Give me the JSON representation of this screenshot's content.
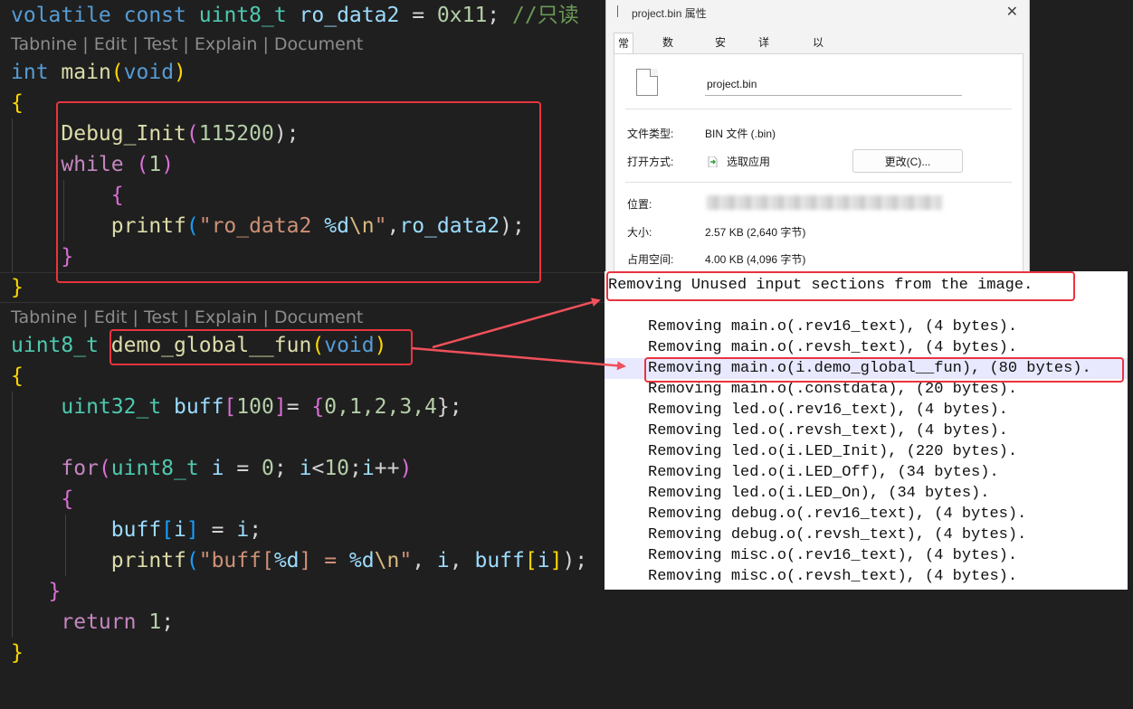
{
  "editor": {
    "codelens": "Tabnine | Edit | Test | Explain | Document",
    "line_rodata": {
      "t1": "volatile",
      "t2": "const",
      "t3": "uint8_t",
      "t4": "ro_data2",
      "t5": "=",
      "t6": "0x11",
      "t7": ";",
      "t8": "//只读"
    },
    "main_sig": {
      "t1": "int",
      "t2": "main",
      "t3": "(",
      "t4": "void",
      "t5": ")"
    },
    "brace_open": "{",
    "brace_close": "}",
    "debug_init": {
      "t1": "Debug_Init",
      "t2": "(",
      "t3": "115200",
      "t4": ");"
    },
    "while_line": {
      "t1": "while",
      "t2": "(",
      "t3": "1",
      "t4": ")"
    },
    "printf1": {
      "t1": "printf",
      "t2": "(",
      "t3": "\"ro_data2 ",
      "t4": "%d",
      "t5": "\\n",
      "t6": "\"",
      "t7": ",",
      "t8": "ro_data2",
      "t9": ");"
    },
    "fun_sig": {
      "t1": "uint8_t",
      "t2": "demo_global__fun",
      "t3": "(",
      "t4": "void",
      "t5": ")"
    },
    "buff_decl": {
      "t1": "uint32_t",
      "t2": "buff",
      "t3": "[",
      "t4": "100",
      "t5": "]",
      "t6": "=",
      "t7": "{",
      "t8": "0,1,2,3,4",
      "t9": "};"
    },
    "for_line": {
      "t1": "for",
      "t2": "(",
      "t3": "uint8_t",
      "t4": "i",
      "t5": "=",
      "t6": "0",
      "t7": ";",
      "t8": "i",
      "t9": "<",
      "t10": "10",
      "t11": ";",
      "t12": "i",
      "t13": "++",
      "t14": ")"
    },
    "assign_line": {
      "t1": "buff",
      "t2": "[",
      "t3": "i",
      "t4": "]",
      "t5": "=",
      "t6": "i",
      "t7": ";"
    },
    "printf2": {
      "t1": "printf",
      "t2": "(",
      "t3": "\"buff[",
      "t4": "%d",
      "t5": "] = ",
      "t6": "%d",
      "t7": "\\n",
      "t8": "\"",
      "t9": ",",
      "t10": "i",
      "t11": ",",
      "t12": "buff",
      "t13": "[",
      "t14": "i",
      "t15": "]",
      "t16": ");"
    },
    "return_line": {
      "t1": "return",
      "t2": "1",
      "t3": ";"
    }
  },
  "properties": {
    "title": "project.bin 属性",
    "close_glyph": "✕",
    "tabs": [
      {
        "label": "常规"
      },
      {
        "label": "数字签名"
      },
      {
        "label": "安全"
      },
      {
        "label": "详细信息"
      },
      {
        "label": "以前的版本"
      }
    ],
    "filename": "project.bin",
    "file_type_label": "文件类型:",
    "file_type_value": "BIN 文件 (.bin)",
    "open_with_label": "打开方式:",
    "open_with_value": "选取应用",
    "change_button": "更改(C)...",
    "location_label": "位置:",
    "size_label": "大小:",
    "size_value": "2.57 KB (2,640 字节)",
    "disk_label": "占用空间:",
    "disk_value": "4.00 KB (4,096 字节)"
  },
  "linker": {
    "header": "Removing Unused input sections from the image.",
    "rows": [
      "Removing main.o(.rev16_text), (4 bytes).",
      "Removing main.o(.revsh_text), (4 bytes).",
      "Removing main.o(i.demo_global__fun), (80 bytes).",
      "Removing main.o(.constdata), (20 bytes).",
      "Removing led.o(.rev16_text), (4 bytes).",
      "Removing led.o(.revsh_text), (4 bytes).",
      "Removing led.o(i.LED_Init), (220 bytes).",
      "Removing led.o(i.LED_Off), (34 bytes).",
      "Removing led.o(i.LED_On), (34 bytes).",
      "Removing debug.o(.rev16_text), (4 bytes).",
      "Removing debug.o(.revsh_text), (4 bytes).",
      "Removing misc.o(.rev16_text), (4 bytes).",
      "Removing misc.o(.revsh_text), (4 bytes)."
    ]
  },
  "colors": {
    "highlight_red": "#e8343f",
    "arrow_red": "#f0505a"
  }
}
